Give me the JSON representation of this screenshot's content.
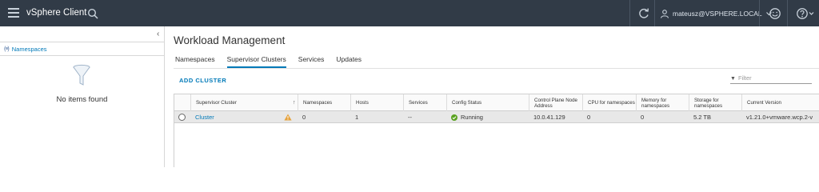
{
  "header": {
    "app_title": "vSphere Client",
    "user": "mateusz@VSPHERE.LOCAL"
  },
  "sidebar": {
    "nav_item": "Namespaces",
    "empty_text": "No items found"
  },
  "main": {
    "title": "Workload Management",
    "tabs": [
      {
        "label": "Namespaces",
        "active": false
      },
      {
        "label": "Supervisor Clusters",
        "active": true
      },
      {
        "label": "Services",
        "active": false
      },
      {
        "label": "Updates",
        "active": false
      }
    ],
    "add_cluster_label": "ADD CLUSTER",
    "filter_placeholder": "Filter"
  },
  "table": {
    "columns": [
      "Supervisor Cluster",
      "Namespaces",
      "Hosts",
      "Services",
      "Config Status",
      "Control Plane Node Address",
      "CPU for namespaces",
      "Memory for namespaces",
      "Storage for namespaces",
      "Current Version"
    ],
    "rows": [
      {
        "cluster": "Cluster",
        "namespaces": "0",
        "hosts": "1",
        "services": "--",
        "config_status": "Running",
        "control_plane": "10.0.41.129",
        "cpu": "0",
        "memory": "0",
        "storage": "5.2 TB",
        "version": "v1.21.0+vmware.wcp.2-v"
      }
    ]
  },
  "colors": {
    "header_bg": "#313b47",
    "accent": "#0079b8",
    "warning": "#e6a23c",
    "ok": "#5aa220"
  }
}
